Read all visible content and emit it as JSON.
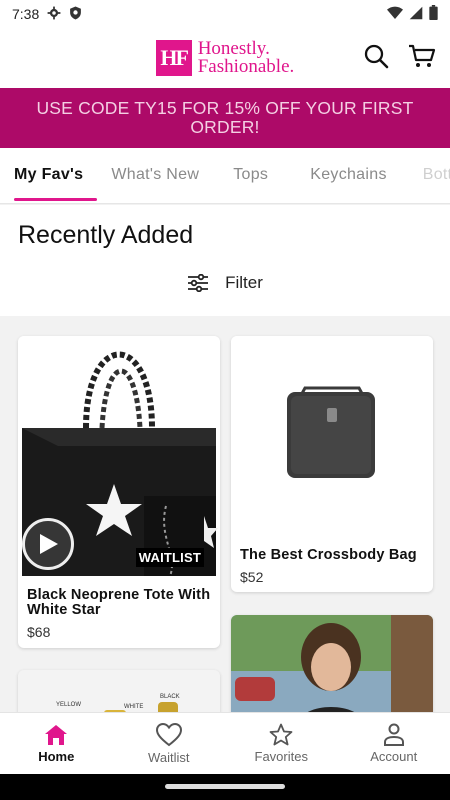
{
  "status_bar": {
    "time": "7:38"
  },
  "brand": {
    "logo_mark": "HF",
    "line1": "Honestly.",
    "line2": "Fashionable.",
    "accent_color": "#e0168c"
  },
  "promo": {
    "text": "USE CODE TY15 FOR 15% OFF YOUR FIRST ORDER!",
    "bg_color": "#ad0a68"
  },
  "tabs": [
    {
      "label": "My Fav's",
      "active": true
    },
    {
      "label": "What's New",
      "active": false
    },
    {
      "label": "Tops",
      "active": false
    },
    {
      "label": "Keychains",
      "active": false
    },
    {
      "label": "Bott",
      "active": false
    }
  ],
  "section": {
    "title": "Recently Added",
    "filter_label": "Filter"
  },
  "products": [
    {
      "title": "Black Neoprene Tote With White Star",
      "price": "$68",
      "badge": "WAITLIST",
      "has_video": true
    },
    {
      "title": "The Best Crossbody Bag",
      "price": "$52"
    }
  ],
  "partial_products": {
    "label_yellow": "YELLOW",
    "label_white": "WHITE",
    "label_black": "BLACK"
  },
  "bottom_nav": [
    {
      "label": "Home",
      "icon": "home-icon",
      "active": true
    },
    {
      "label": "Waitlist",
      "icon": "heart-icon",
      "active": false
    },
    {
      "label": "Favorites",
      "icon": "star-icon",
      "active": false
    },
    {
      "label": "Account",
      "icon": "person-icon",
      "active": false
    }
  ]
}
